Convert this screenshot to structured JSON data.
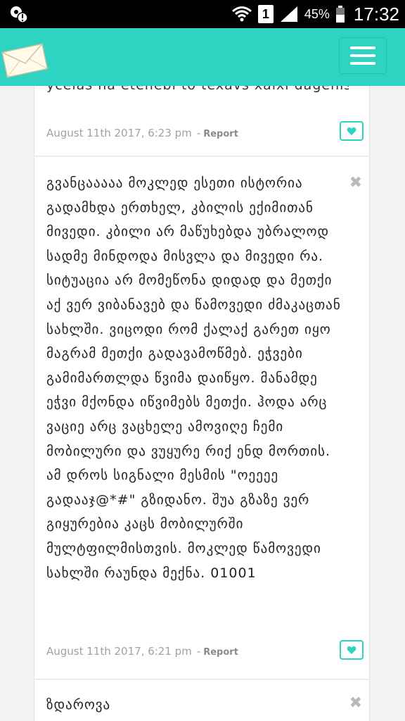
{
  "status_bar": {
    "sim_number": "1",
    "battery_percent": "45%",
    "time": "17:32"
  },
  "app_bar": {
    "logo_icon": "envelope-icon",
    "menu_icon": "hamburger-menu-icon",
    "accent_color": "#2fd3c2"
  },
  "comments": [
    {
      "text": "ÿcelas na etenebi to texavs xaixi dagenis.",
      "close_glyph": "✖",
      "date": "August 11th 2017, 6:23 pm",
      "separator": "-",
      "report_label": "Report",
      "like_icon": "heart-icon"
    },
    {
      "text": "გვანცააააა მოკლედ ესეთი ისტორია გადამხდა ერთხელ, კბილის ექიმითან მივედი. კბილი არ მაწუხებდა უბრალოდ სადმე მინდოდა მისვლა და მივედი რა. სიტუაცია არ მომეწონა დიდად და მეთქი აქ ვერ ვიბანავებ და წამოვედი ძმაკაცთან სახლში. ვიცოდი რომ ქალაქ გარეთ იყო მაგრამ მეთქი გადავამოწმებ. ეჭვები გამიმართლდა წვიმა დაიწყო. მანამდე ეჭვი მქონდა იწვიმებს მეთქი. ჰოდა არც ვაციე არც ვაცხელე ამოვიღე ჩემი მობილური და ვუყურე რიქ ენდ მორთის. ამ დროს სიგნალი მესმის \"ოეეეე გადააჯ@*#\" გზიდანო. შუა გზაზე ვერ გიყურებია კაცს მობილურში მულტფილმისთვის. მოკლედ წამოვედი სახლში რაუნდა მექნა. 01001",
      "close_glyph": "✖",
      "date": "August 11th 2017, 6:21 pm",
      "separator": "-",
      "report_label": "Report",
      "like_icon": "heart-icon"
    },
    {
      "text": "ზდაროვა",
      "close_glyph": "✖"
    }
  ]
}
